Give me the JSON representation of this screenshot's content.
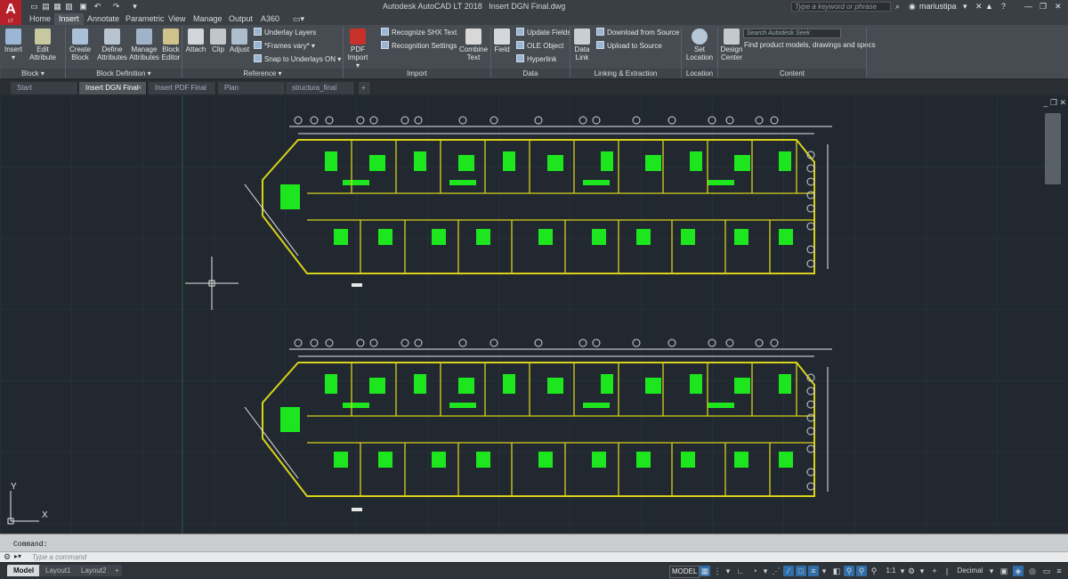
{
  "titlebar": {
    "app": "Autodesk AutoCAD LT 2018",
    "file": "Insert DGN Final.dwg",
    "search_placeholder": "Type a keyword or phrase",
    "user": "mariustipa",
    "logo": "A",
    "logo_sub": "LT"
  },
  "menu_tabs": [
    "Home",
    "Insert",
    "Annotate",
    "Parametric",
    "View",
    "Manage",
    "Output",
    "A360"
  ],
  "ribbon": {
    "insert": "Insert",
    "edit_attribute": [
      "Edit",
      "Attribute"
    ],
    "create_block": [
      "Create",
      "Block"
    ],
    "define_attributes": [
      "Define",
      "Attributes"
    ],
    "manage_attributes": [
      "Manage",
      "Attributes"
    ],
    "block_editor": [
      "Block",
      "Editor"
    ],
    "attach": "Attach",
    "clip": "Clip",
    "adjust": "Adjust",
    "underlay_layers": "Underlay Layers",
    "frames_vary": "*Frames vary*",
    "snap_underlays": "Snap to Underlays ON",
    "pdf_import": [
      "PDF",
      "Import"
    ],
    "recognize_shx": "Recognize SHX Text",
    "recognition_settings": "Recognition Settings",
    "combine_text": [
      "Combine",
      "Text"
    ],
    "field": "Field",
    "update_fields": "Update Fields",
    "ole_object": "OLE Object",
    "hyperlink": "Hyperlink",
    "data_link": [
      "Data",
      "Link"
    ],
    "download_source": "Download from Source",
    "upload_source": "Upload to Source",
    "set_location": [
      "Set",
      "Location"
    ],
    "design_center": [
      "Design",
      "Center"
    ],
    "seek_placeholder": "Search Autodesk Seek",
    "seek_text": "Find product models, drawings and specs",
    "panels": {
      "block": "Block",
      "block_def": "Block Definition",
      "reference": "Reference",
      "import": "Import",
      "data": "Data",
      "linking": "Linking & Extraction",
      "location": "Location",
      "content": "Content"
    }
  },
  "doc_tabs": [
    "Start",
    "Insert DGN Final",
    "Insert PDF Final",
    "Plan",
    "structura_final"
  ],
  "ucs": {
    "x": "X",
    "y": "Y"
  },
  "command": {
    "history": "Command:",
    "placeholder": "Type a command"
  },
  "layout_tabs": [
    "Model",
    "Layout1",
    "Layout2"
  ],
  "status": {
    "model": "MODEL",
    "scale": "1:1",
    "units": "Decimal"
  }
}
